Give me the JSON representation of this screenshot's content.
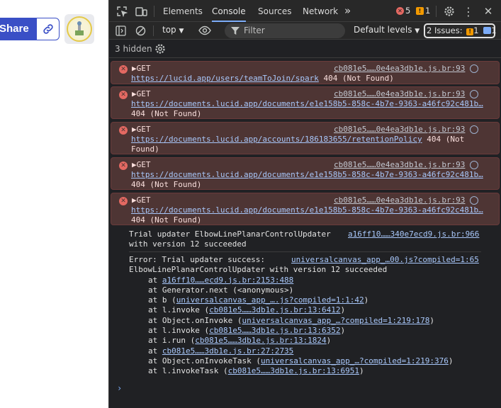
{
  "app": {
    "share_label": "Share"
  },
  "devtools": {
    "tabs": [
      "Elements",
      "Console",
      "Sources",
      "Network"
    ],
    "active_tab": "Console",
    "error_count": "5",
    "warning_count": "1",
    "toolbar": {
      "context": "top",
      "filter_placeholder": "Filter",
      "levels": "Default levels",
      "issues_label": "2 Issues:",
      "issues_warn": "1",
      "issues_info": "1"
    },
    "hidden_label": "3 hidden",
    "errors": [
      {
        "method": "GET",
        "source": "cb081e5……0e4ea3db1e.js.br:93",
        "url": "https://lucid.app/users/teamToJoin/spark",
        "status": "404 (Not Found)"
      },
      {
        "method": "GET",
        "source": "cb081e5……0e4ea3db1e.js.br:93",
        "url": "https://documents.lucid.app/documents/e1e158b5-858c-4b7e-9363-a46fc92c481b…",
        "status": "404 (Not Found)"
      },
      {
        "method": "GET",
        "source": "cb081e5……0e4ea3db1e.js.br:93",
        "url": "https://documents.lucid.app/accounts/186183655/retentionPolicy",
        "status": "404 (Not Found)"
      },
      {
        "method": "GET",
        "source": "cb081e5……0e4ea3db1e.js.br:93",
        "url": "https://documents.lucid.app/documents/e1e158b5-858c-4b7e-9363-a46fc92c481b…",
        "status": "404 (Not Found)"
      },
      {
        "method": "GET",
        "source": "cb081e5……0e4ea3db1e.js.br:93",
        "url": "https://documents.lucid.app/documents/e1e158b5-858c-4b7e-9363-a46fc92c481b…",
        "status": "404 (Not Found)"
      }
    ],
    "log1": {
      "text_line1": "Trial updater ElbowLinePlanarControlUpdater",
      "text_line2": "with version 12 succeeded",
      "source": "a16ff10……340e7ecd9.js.br:966"
    },
    "log2": {
      "text_line1": "Error: Trial updater success:",
      "source": "universalcanvas_app_…00.js?compiled=1:65",
      "text_line2": "ElbowLinePlanarControlUpdater with version 12 succeeded",
      "trace": [
        {
          "pre": "at ",
          "link": "a16ff10……ecd9.js.br:2153:488",
          "post": ""
        },
        {
          "pre": "at Generator.next (<anonymous>)",
          "link": "",
          "post": ""
        },
        {
          "pre": "at b (",
          "link": "universalcanvas_app_….js?compiled=1:1:42",
          "post": ")"
        },
        {
          "pre": "at l.invoke (",
          "link": "cb081e5……3db1e.js.br:13:6412",
          "post": ")"
        },
        {
          "pre": "at Object.onInvoke (",
          "link": "universalcanvas_app_…?compiled=1:219:178",
          "post": ")"
        },
        {
          "pre": "at l.invoke (",
          "link": "cb081e5……3db1e.js.br:13:6352",
          "post": ")"
        },
        {
          "pre": "at i.run (",
          "link": "cb081e5……3db1e.js.br:13:1824",
          "post": ")"
        },
        {
          "pre": "at ",
          "link": "cb081e5……3db1e.js.br:27:2735",
          "post": ""
        },
        {
          "pre": "at Object.onInvokeTask (",
          "link": "universalcanvas_app_…?compiled=1:219:376",
          "post": ")"
        },
        {
          "pre": "at l.invokeTask (",
          "link": "cb081e5……3db1e.js.br:13:6951",
          "post": ")"
        }
      ]
    },
    "prompt_glyph": "›"
  }
}
